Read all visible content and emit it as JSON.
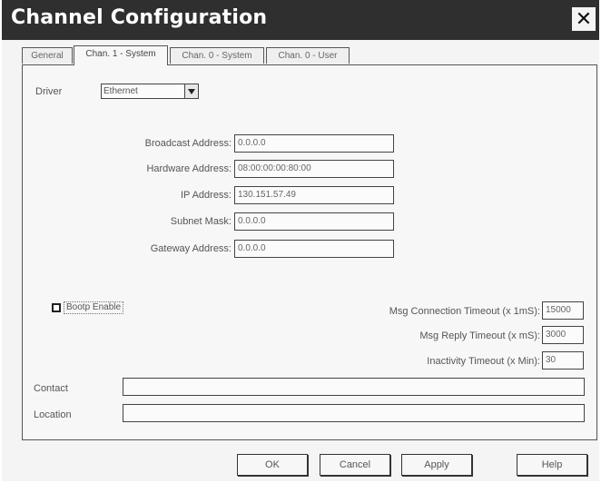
{
  "window": {
    "title": "Channel Configuration",
    "close_glyph": "✕"
  },
  "tabs": [
    {
      "label": "General",
      "active": false
    },
    {
      "label": "Chan. 1 - System",
      "active": true
    },
    {
      "label": "Chan. 0 - System",
      "active": false
    },
    {
      "label": "Chan. 0 - User",
      "active": false
    }
  ],
  "driver": {
    "label": "Driver",
    "value": "Ethernet",
    "icon": "chevron-down-icon"
  },
  "address_fields": [
    {
      "label": "Broadcast Address:",
      "value": "0.0.0.0"
    },
    {
      "label": "Hardware Address:",
      "value": "08:00:00:00:80:00"
    },
    {
      "label": "IP Address:",
      "value": "130.151.57.49"
    },
    {
      "label": "Subnet Mask:",
      "value": "0.0.0.0"
    },
    {
      "label": "Gateway Address:",
      "value": "0.0.0.0"
    }
  ],
  "bootp": {
    "label": "Bootp Enable",
    "checked": false
  },
  "timeouts": [
    {
      "label": "Msg Connection Timeout (x 1mS):",
      "value": "15000"
    },
    {
      "label": "Msg Reply Timeout (x mS):",
      "value": "3000"
    },
    {
      "label": "Inactivity Timeout (x Min):",
      "value": "30"
    }
  ],
  "contact": {
    "label": "Contact",
    "value": ""
  },
  "location": {
    "label": "Location",
    "value": ""
  },
  "buttons": {
    "ok": "OK",
    "cancel": "Cancel",
    "apply": "Apply",
    "help": "Help"
  },
  "colors": {
    "titlebar": "#2f2f2f",
    "dialog_bg": "#f4f4f4",
    "border": "#444444"
  }
}
